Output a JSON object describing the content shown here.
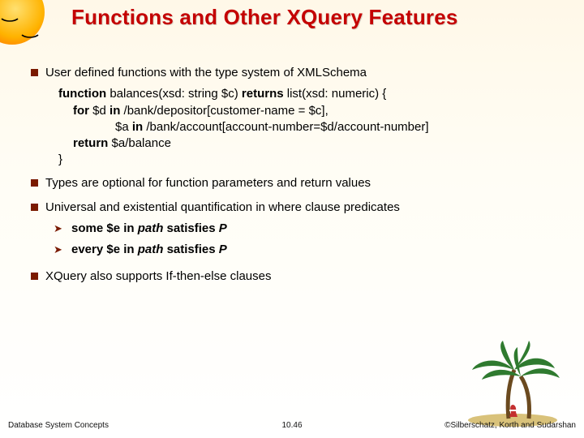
{
  "title": "Functions and Other XQuery Features",
  "bullets": {
    "b1": "User defined functions with the type system of XMLSchema",
    "code": {
      "l1a": "function",
      "l1b": " balances(xsd: string $c) ",
      "l1c": "returns",
      "l1d": " list(xsd: numeric) {",
      "l2a": "for",
      "l2b": " $d ",
      "l2c": "in",
      "l2d": " /bank/depositor[customer-name = $c],",
      "l3a": "$a ",
      "l3b": "in",
      "l3c": " /bank/account[account-number=$d/account-number]",
      "l4a": "return",
      "l4b": " $a/balance",
      "l5": "}"
    },
    "b2": "Types are optional for function parameters and return values",
    "b3": "Universal and existential quantification in where clause predicates",
    "s1a": "some $e in ",
    "s1b": "path",
    "s1c": " satisfies ",
    "s1d": "P",
    "s2a": "every $e in ",
    "s2b": "path",
    "s2c": " satisfies ",
    "s2d": "P",
    "b4": "XQuery also supports If-then-else clauses"
  },
  "footer": {
    "left": "Database System Concepts",
    "center": "10.46",
    "right": "©Silberschatz, Korth and Sudarshan"
  }
}
